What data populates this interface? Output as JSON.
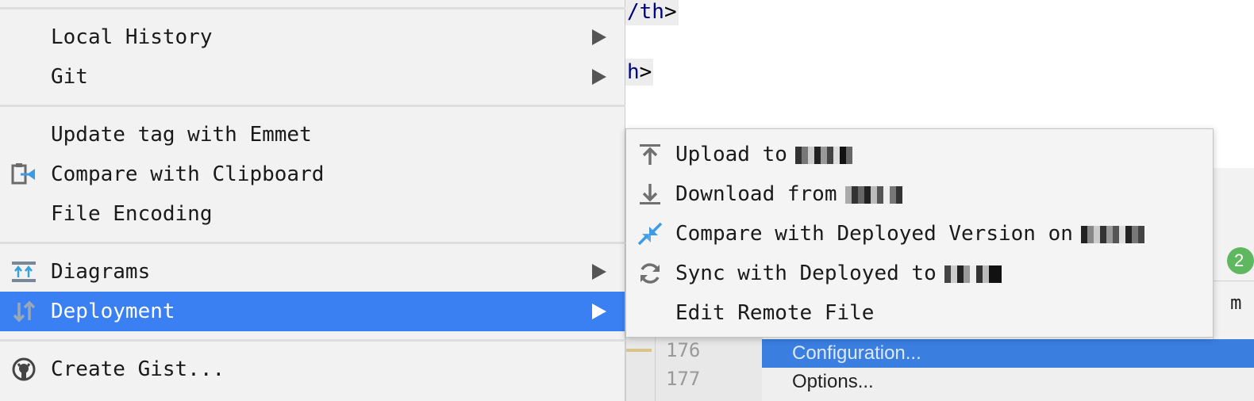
{
  "editor": {
    "code_line1_tag": "/th",
    "code_line1_bracket": ">",
    "code_line2_tag": "h",
    "code_line2_bracket": ">",
    "line_numbers": [
      "176",
      "177"
    ],
    "badge_value": "2",
    "edge_text": "m"
  },
  "bottom_menu": {
    "items": [
      {
        "label": "Configuration..."
      },
      {
        "label": "Options..."
      }
    ]
  },
  "menu": {
    "items": [
      {
        "label": "Local History",
        "icon": "none",
        "has_submenu": true
      },
      {
        "label": "Git",
        "icon": "none",
        "has_submenu": true
      },
      {
        "label": "Update tag with Emmet",
        "icon": "none",
        "has_submenu": false
      },
      {
        "label": "Compare with Clipboard",
        "icon": "clipboard-compare-icon",
        "has_submenu": false
      },
      {
        "label": "File Encoding",
        "icon": "none",
        "has_submenu": false
      },
      {
        "label": "Diagrams",
        "icon": "diagram-icon",
        "has_submenu": true
      },
      {
        "label": "Deployment",
        "icon": "deployment-arrows-icon",
        "has_submenu": true,
        "active": true
      },
      {
        "label": "Create Gist...",
        "icon": "github-icon",
        "has_submenu": false
      }
    ]
  },
  "submenu": {
    "items": [
      {
        "label": "Upload to",
        "icon": "upload-icon",
        "redacted": true
      },
      {
        "label": "Download from",
        "icon": "download-icon",
        "redacted": true
      },
      {
        "label": "Compare with Deployed Version on",
        "icon": "compare-arrows-icon",
        "redacted": true
      },
      {
        "label": "Sync with Deployed to",
        "icon": "sync-icon",
        "redacted": true
      },
      {
        "label": "Edit Remote File",
        "icon": "none",
        "redacted": false
      }
    ]
  },
  "colors": {
    "highlight": "#3a80f2",
    "menu_bg": "#f2f2f2",
    "code_tag": "#000080",
    "badge": "#5fb760"
  }
}
